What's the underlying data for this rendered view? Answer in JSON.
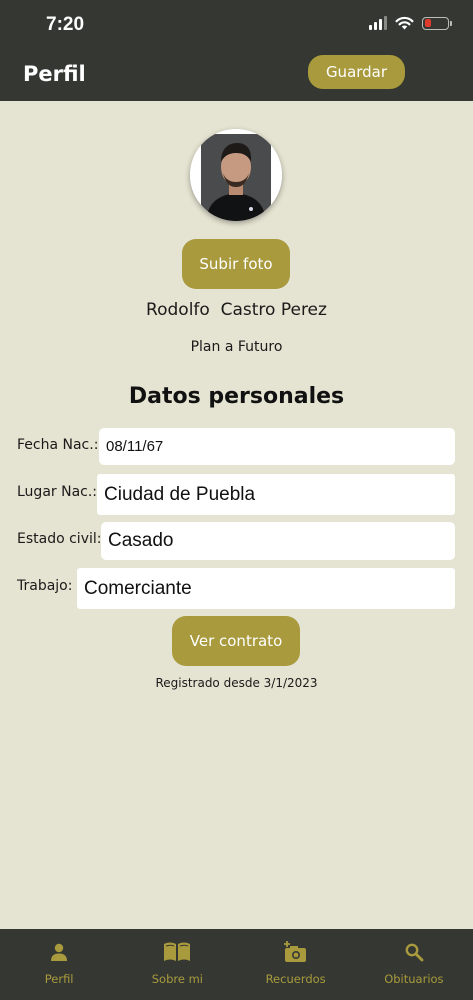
{
  "status_bar": {
    "time": "7:20"
  },
  "header": {
    "title": "Perfil",
    "save_label": "Guardar"
  },
  "profile": {
    "upload_label": "Subir foto",
    "name": "Rodolfo  Castro Perez",
    "plan": "Plan a Futuro"
  },
  "personal": {
    "title": "Datos personales",
    "fields": [
      {
        "label": "Fecha Nac.:",
        "value": "08/11/67"
      },
      {
        "label": "Lugar Nac.:",
        "value": "Ciudad de Puebla"
      },
      {
        "label": "Estado civil:",
        "value": "Casado"
      },
      {
        "label": "Trabajo:",
        "value": "Comerciante"
      }
    ]
  },
  "contract_label": "Ver contrato",
  "registered": "Registrado desde 3/1/2023",
  "tabs": [
    {
      "label": "Perfil",
      "icon": "person-icon"
    },
    {
      "label": "Sobre mi",
      "icon": "book-icon"
    },
    {
      "label": "Recuerdos",
      "icon": "add-photo-icon"
    },
    {
      "label": "Obituarios",
      "icon": "search-icon"
    }
  ],
  "colors": {
    "accent": "#A89A3D",
    "dark": "#353832",
    "background": "#E5E3D1"
  }
}
